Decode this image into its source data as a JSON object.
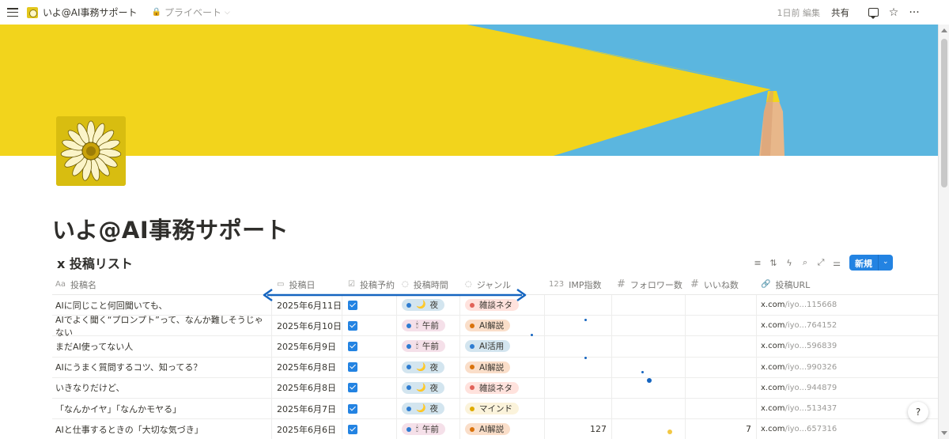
{
  "topbar": {
    "page_title": "いよ@AI事務サポート",
    "privacy": "プライベート",
    "edited": "1日前 編集",
    "share": "共有"
  },
  "page": {
    "title": "いよ@AI事務サポート"
  },
  "database": {
    "title": "x 投稿リスト",
    "new_label": "新規",
    "columns": [
      {
        "label": "投稿名",
        "icon": "Aa"
      },
      {
        "label": "投稿日",
        "icon": "calendar-icon"
      },
      {
        "label": "投稿予約",
        "icon": "checkbox-icon"
      },
      {
        "label": "投稿時間",
        "icon": "status-icon"
      },
      {
        "label": "ジャンル",
        "icon": "status-icon"
      },
      {
        "label": "IMP指数",
        "icon": "123"
      },
      {
        "label": "フォロワー数",
        "icon": "#"
      },
      {
        "label": "いいね数",
        "icon": "#"
      },
      {
        "label": "投稿URL",
        "icon": "link-icon"
      }
    ],
    "rows": [
      {
        "name": "AIに同じこと何回聞いても、",
        "date": "2025年6月11日",
        "time_emoji": "🌙",
        "time": "夜",
        "time_color": "#d3e5ef",
        "genre": "雑談ネタ",
        "genre_color": "#ffe2dd",
        "genre_dot": "#e16259",
        "imp": "",
        "likes": "",
        "url_domain": "x.com",
        "url_rest": "/iyo...115668"
      },
      {
        "name": "AIでよく聞く“プロンプト”って、なんか難しそうじゃない",
        "date": "2025年6月10日",
        "time_emoji": "🕯",
        "time": "午前",
        "time_color": "#f5e0e9",
        "genre": "AI解説",
        "genre_color": "#fadec9",
        "genre_dot": "#d9730d",
        "imp": "",
        "likes": "",
        "url_domain": "x.com",
        "url_rest": "/iyo...764152"
      },
      {
        "name": "まだAI使ってない人",
        "date": "2025年6月9日",
        "time_emoji": "🕯",
        "time": "午前",
        "time_color": "#f5e0e9",
        "genre": "AI活用",
        "genre_color": "#d3e5ef",
        "genre_dot": "#2e7cd1",
        "imp": "",
        "likes": "",
        "url_domain": "x.com",
        "url_rest": "/iyo...596839"
      },
      {
        "name": "AIにうまく質問するコツ、知ってる？",
        "date": "2025年6月8日",
        "time_emoji": "🌙",
        "time": "夜",
        "time_color": "#d3e5ef",
        "genre": "AI解説",
        "genre_color": "#fadec9",
        "genre_dot": "#d9730d",
        "imp": "",
        "likes": "",
        "url_domain": "x.com",
        "url_rest": "/iyo...990326"
      },
      {
        "name": "いきなりだけど、",
        "date": "2025年6月8日",
        "time_emoji": "🌙",
        "time": "夜",
        "time_color": "#d3e5ef",
        "genre": "雑談ネタ",
        "genre_color": "#ffe2dd",
        "genre_dot": "#e16259",
        "imp": "",
        "likes": "",
        "url_domain": "x.com",
        "url_rest": "/iyo...944879"
      },
      {
        "name": "「なんかイヤ」「なんかモヤる」",
        "date": "2025年6月7日",
        "time_emoji": "🌙",
        "time": "夜",
        "time_color": "#d3e5ef",
        "genre": "マインド",
        "genre_color": "#fbf3db",
        "genre_dot": "#dfab01",
        "imp": "",
        "likes": "",
        "url_domain": "x.com",
        "url_rest": "/iyo...513437"
      },
      {
        "name": "AIと仕事するときの「大切な気づき」",
        "date": "2025年6月6日",
        "time_emoji": "🕯",
        "time": "午前",
        "time_color": "#f5e0e9",
        "genre": "AI解説",
        "genre_color": "#fadec9",
        "genre_dot": "#d9730d",
        "imp": "127",
        "likes": "7",
        "url_domain": "x.com",
        "url_rest": "/iyo...657316"
      }
    ]
  },
  "colors": {
    "accent": "#2383e2",
    "cover_yellow": "#f2d41c",
    "cover_blue": "#5bb6df",
    "arrow": "#1565c0"
  },
  "help": "?"
}
